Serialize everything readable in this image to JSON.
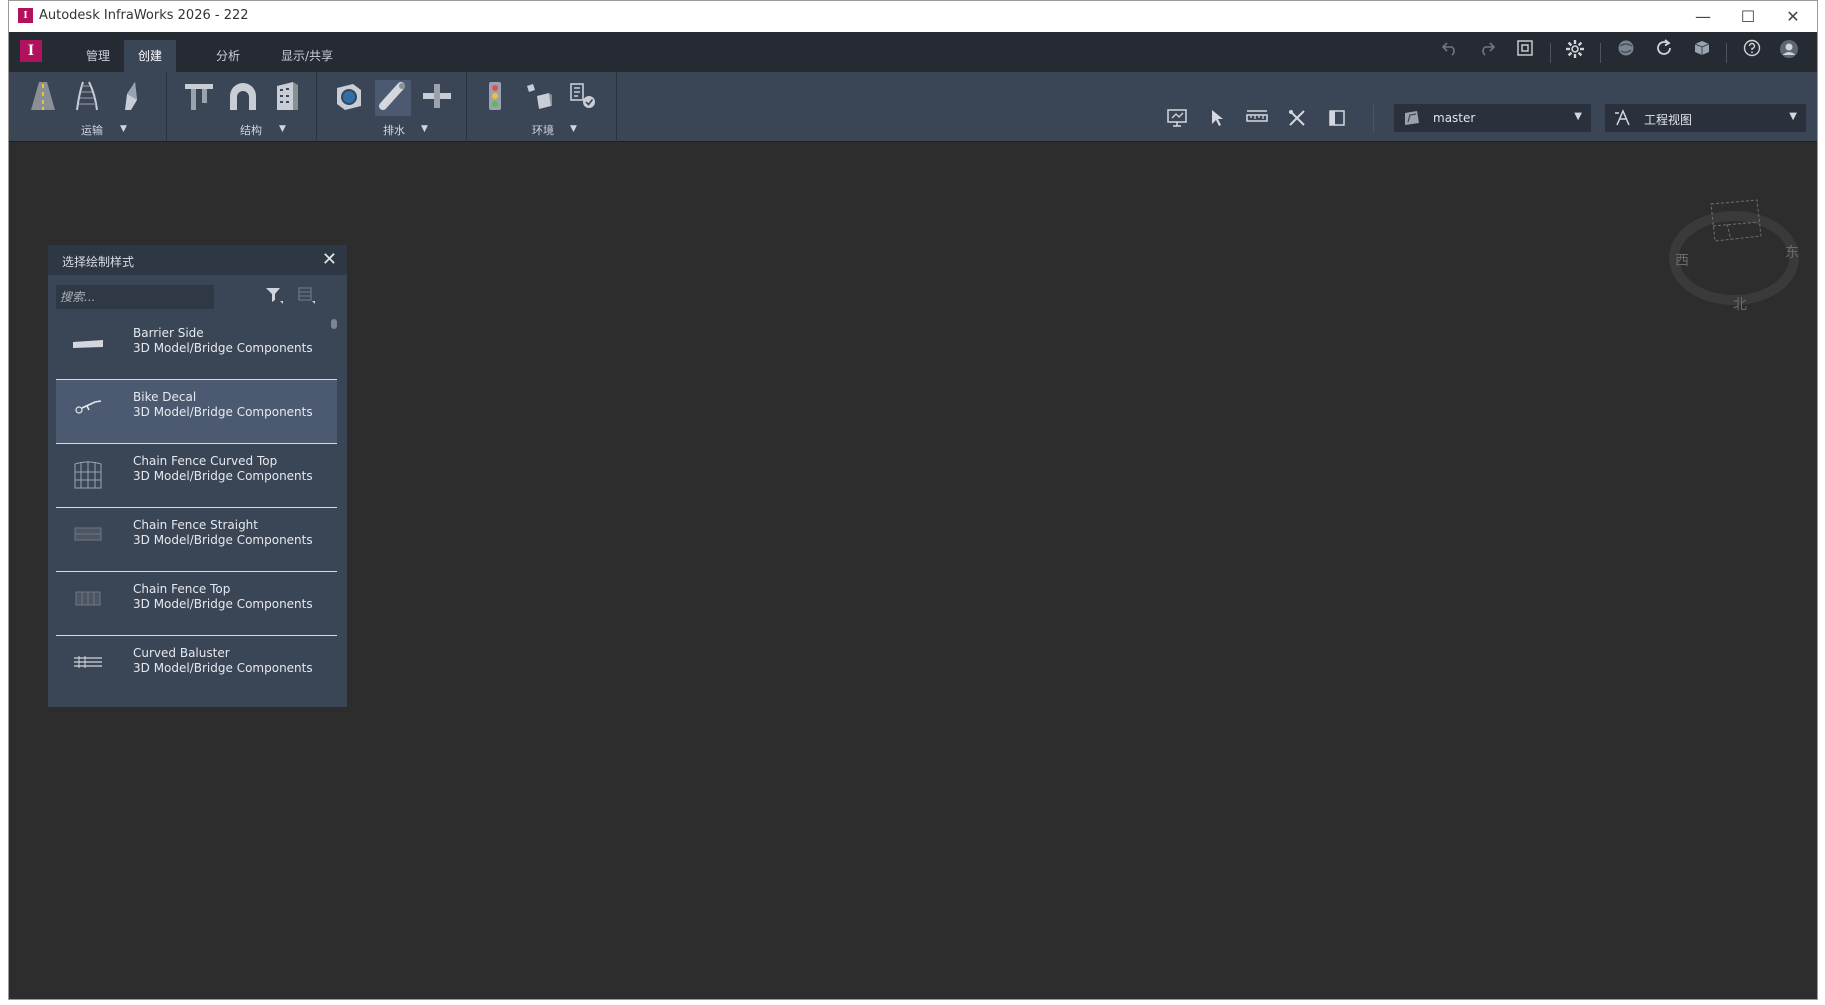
{
  "window": {
    "title": "Autodesk InfraWorks 2026 - 222",
    "app_icon_letter": "I",
    "controls": {
      "minimize": "—",
      "maximize": "☐",
      "close": "✕"
    }
  },
  "menubar": {
    "logo_letter": "I",
    "tabs": [
      {
        "label": "管理",
        "active": false
      },
      {
        "label": "创建",
        "active": true
      },
      {
        "label": "分析",
        "active": false
      },
      {
        "label": "显示/共享",
        "active": false
      }
    ],
    "icons": [
      "undo-icon",
      "redo-icon",
      "fit-view-icon",
      "settings-icon",
      "globe-icon",
      "sync-icon",
      "cloud-model-icon",
      "help-icon",
      "user-avatar-icon"
    ]
  },
  "ribbon": {
    "groups": [
      {
        "label": "运输"
      },
      {
        "label": "结构"
      },
      {
        "label": "排水"
      },
      {
        "label": "环境"
      }
    ],
    "branch": {
      "value": "master"
    },
    "view": {
      "value": "工程视图"
    }
  },
  "panel": {
    "title": "选择绘制样式",
    "search_placeholder": "搜索...",
    "items": [
      {
        "name": "Barrier Side",
        "category": "3D Model/Bridge Components",
        "selected": false
      },
      {
        "name": "Bike Decal",
        "category": "3D Model/Bridge Components",
        "selected": true
      },
      {
        "name": "Chain Fence Curved Top",
        "category": "3D Model/Bridge Components",
        "selected": false
      },
      {
        "name": "Chain Fence Straight",
        "category": "3D Model/Bridge Components",
        "selected": false
      },
      {
        "name": "Chain Fence Top",
        "category": "3D Model/Bridge Components",
        "selected": false
      },
      {
        "name": "Curved Baluster",
        "category": "3D Model/Bridge Components",
        "selected": false
      }
    ]
  },
  "viewcube": {
    "north": "北",
    "east": "东",
    "west": "西"
  },
  "colors": {
    "accent": "#b0125e",
    "canvas": "#2d2d2d",
    "ribbon": "#3a4556",
    "menubar": "#262b33",
    "selected_row": "#4b5a71"
  }
}
